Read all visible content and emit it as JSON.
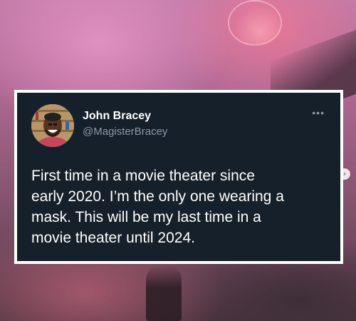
{
  "tweet": {
    "name": "John Bracey",
    "handle": "@MagisterBracey",
    "text": "First time in a movie theater since\nearly 2020. I’m the only one wearing a\nmask. This will be my last time in a\nmovie theater until 2024.",
    "more_icon": "more-horizontal-icon"
  },
  "carousel": {
    "next_icon": "chevron-right-icon",
    "glyph": "›"
  },
  "colors": {
    "card_bg": "#15202b",
    "card_border": "#ffffff",
    "secondary_text": "#8b98a5"
  }
}
